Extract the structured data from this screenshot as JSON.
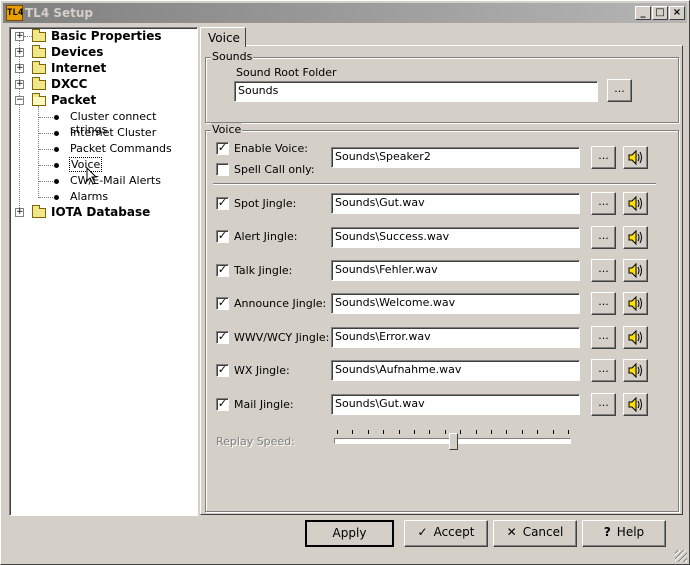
{
  "window": {
    "title": "TL4 Setup",
    "app_icon": "TL4",
    "controls": [
      "minimize-icon",
      "maximize-icon",
      "close-icon"
    ]
  },
  "tree": {
    "nodes": [
      {
        "label": "Basic Properties",
        "expanded": false
      },
      {
        "label": "Devices",
        "expanded": false
      },
      {
        "label": "Internet",
        "expanded": false
      },
      {
        "label": "DXCC",
        "expanded": false
      },
      {
        "label": "Packet",
        "expanded": true,
        "children": [
          "Cluster connect strings",
          "Internet Cluster",
          "Packet Commands",
          "Voice",
          "CW/E-Mail Alerts",
          "Alarms"
        ]
      },
      {
        "label": "IOTA Database",
        "expanded": false
      }
    ],
    "selected": "Voice"
  },
  "tab": {
    "label": "Voice"
  },
  "sounds_group": {
    "title": "Sounds",
    "root_folder_label": "Sound Root Folder",
    "root_folder_value": "Sounds",
    "browse_label": "..."
  },
  "voice_group": {
    "title": "Voice",
    "enable_voice": {
      "label": "Enable Voice:",
      "checked": true,
      "value": "Sounds\\Speaker2"
    },
    "spell_call_only": {
      "label": "Spell Call only:",
      "checked": false
    },
    "jingles": [
      {
        "label": "Spot Jingle:",
        "checked": true,
        "value": "Sounds\\Gut.wav"
      },
      {
        "label": "Alert Jingle:",
        "checked": true,
        "value": "Sounds\\Success.wav"
      },
      {
        "label": "Talk Jingle:",
        "checked": true,
        "value": "Sounds\\Fehler.wav"
      },
      {
        "label": "Announce Jingle:",
        "checked": true,
        "value": "Sounds\\Welcome.wav"
      },
      {
        "label": "WWV/WCY Jingle:",
        "checked": true,
        "value": "Sounds\\Error.wav"
      },
      {
        "label": "WX Jingle:",
        "checked": true,
        "value": "Sounds\\Aufnahme.wav"
      },
      {
        "label": "Mail Jingle:",
        "checked": true,
        "value": "Sounds\\Gut.wav"
      }
    ],
    "replay_speed": {
      "label": "Replay Speed:",
      "enabled": false,
      "level": 0.5,
      "ticks": 16
    }
  },
  "buttons": {
    "apply": "Apply",
    "accept": "Accept",
    "cancel": "Cancel",
    "help": "Help"
  },
  "icons": {
    "checkmark": "✓",
    "speaker": "speaker-icon"
  }
}
